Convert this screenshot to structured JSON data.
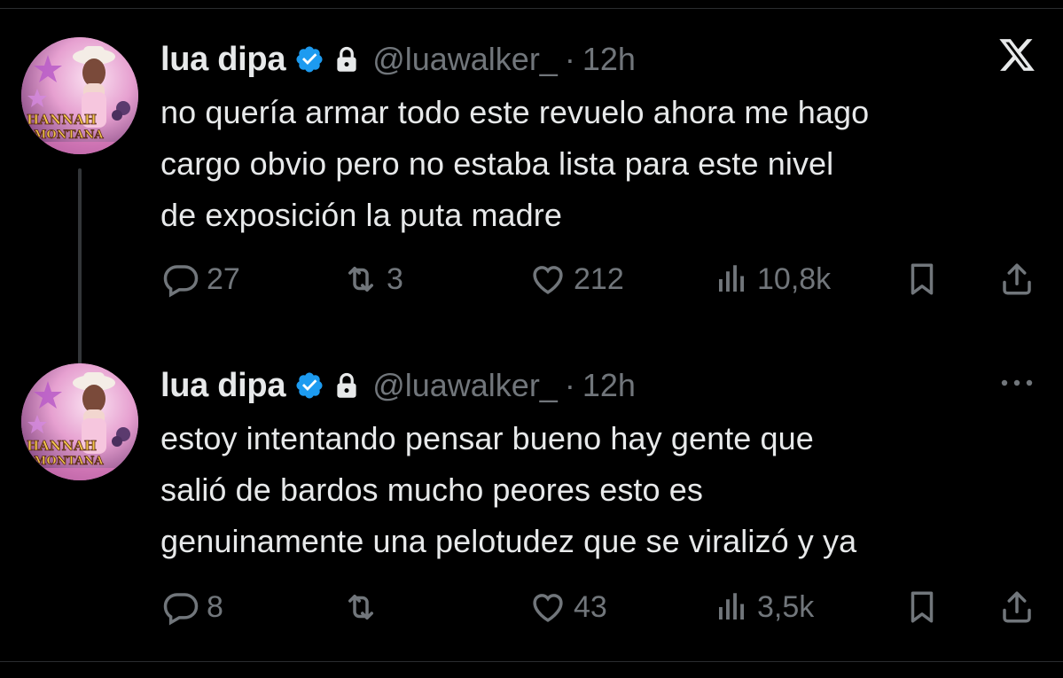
{
  "colors": {
    "background": "#000000",
    "text": "#e7e9ea",
    "muted": "#71767b",
    "verified": "#1d9bf0"
  },
  "tweets": [
    {
      "name": "lua dipa",
      "handle": "@luawalker_",
      "separator": "·",
      "time": "12h",
      "corner_icon": "x-logo-icon",
      "lines": [
        "no quería armar todo este revuelo ahora me hago",
        "cargo obvio pero no estaba lista para este nivel",
        "de exposición la puta madre"
      ],
      "replies": "27",
      "reposts": "3",
      "likes": "212",
      "views": "10,8k"
    },
    {
      "name": "lua dipa",
      "handle": "@luawalker_",
      "separator": "·",
      "time": "12h",
      "corner_icon": "more-icon",
      "lines": [
        "estoy intentando pensar bueno hay gente que",
        "salió de bardos mucho peores esto es",
        "genuinamente una pelotudez que se viralizó y ya"
      ],
      "replies": "8",
      "reposts": "",
      "likes": "43",
      "views": "3,5k"
    }
  ],
  "avatar_text": {
    "line1": "HANNAH",
    "line2": "MONTANA"
  }
}
